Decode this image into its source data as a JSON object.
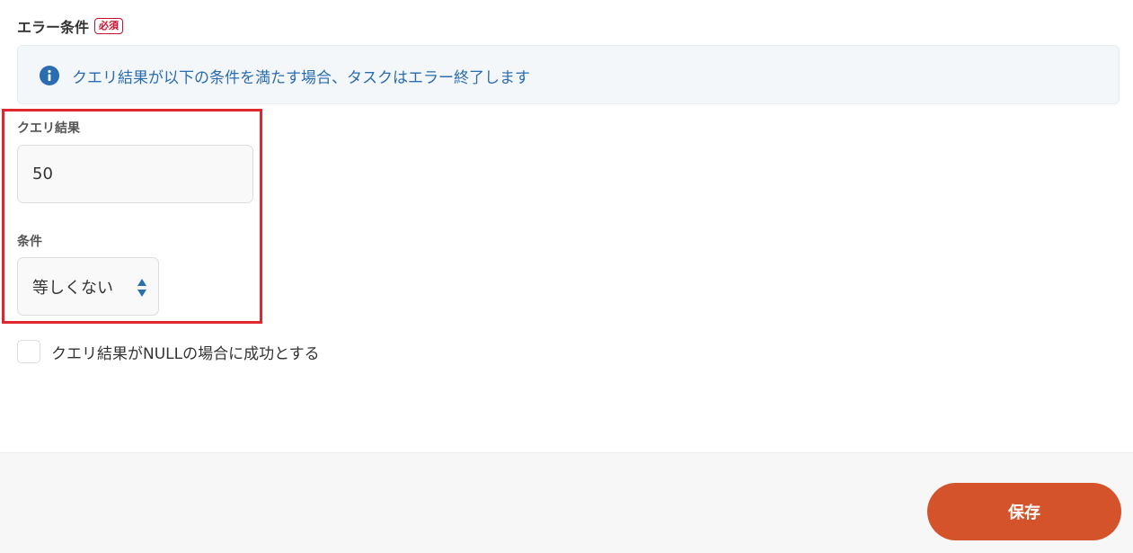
{
  "section": {
    "title": "エラー条件",
    "required_badge": "必須"
  },
  "info": {
    "icon": "info-icon",
    "message": "クエリ結果が以下の条件を満たす場合、タスクはエラー終了します"
  },
  "query_result": {
    "label": "クエリ結果",
    "value": "50"
  },
  "condition": {
    "label": "条件",
    "selected": "等しくない"
  },
  "null_option": {
    "label": "クエリ結果がNULLの場合に成功とする",
    "checked": false
  },
  "footer": {
    "save_label": "保存"
  },
  "colors": {
    "accent": "#d5532a",
    "info": "#2a6db0",
    "required": "#c8102e",
    "highlight": "#e0262f"
  }
}
